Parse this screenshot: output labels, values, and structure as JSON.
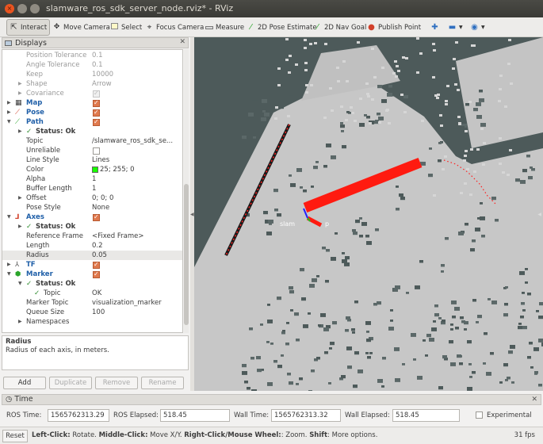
{
  "window": {
    "title": "slamware_ros_sdk_server_node.rviz* - RViz"
  },
  "toolbar": {
    "interact": "Interact",
    "move_camera": "Move Camera",
    "select": "Select",
    "focus_camera": "Focus Camera",
    "measure": "Measure",
    "pose_estimate": "2D Pose Estimate",
    "nav_goal": "2D Nav Goal",
    "publish_point": "Publish Point"
  },
  "displays": {
    "title": "Displays",
    "rows": [
      {
        "key": "Position Tolerance",
        "value": "0.1"
      },
      {
        "key": "Angle Tolerance",
        "value": "0.1"
      },
      {
        "key": "Keep",
        "value": "10000"
      },
      {
        "key": "Shape",
        "value": "Arrow"
      },
      {
        "key": "Covariance",
        "value": ""
      },
      {
        "key": "Map",
        "value": ""
      },
      {
        "key": "Pose",
        "value": ""
      },
      {
        "key": "Path",
        "value": ""
      },
      {
        "key": "Status: Ok",
        "value": ""
      },
      {
        "key": "Topic",
        "value": "/slamware_ros_sdk_se..."
      },
      {
        "key": "Unreliable",
        "value": ""
      },
      {
        "key": "Line Style",
        "value": "Lines"
      },
      {
        "key": "Color",
        "value": "25; 255; 0"
      },
      {
        "key": "Alpha",
        "value": "1"
      },
      {
        "key": "Buffer Length",
        "value": "1"
      },
      {
        "key": "Offset",
        "value": "0; 0; 0"
      },
      {
        "key": "Pose Style",
        "value": "None"
      },
      {
        "key": "Axes",
        "value": ""
      },
      {
        "key": "Status: Ok",
        "value": ""
      },
      {
        "key": "Reference Frame",
        "value": "<Fixed Frame>"
      },
      {
        "key": "Length",
        "value": "0.2"
      },
      {
        "key": "Radius",
        "value": "0.05"
      },
      {
        "key": "TF",
        "value": ""
      },
      {
        "key": "Marker",
        "value": ""
      },
      {
        "key": "Status: Ok",
        "value": ""
      },
      {
        "key": "Topic",
        "value": "OK"
      },
      {
        "key": "Marker Topic",
        "value": "visualization_marker"
      },
      {
        "key": "Queue Size",
        "value": "100"
      },
      {
        "key": "Namespaces",
        "value": ""
      }
    ],
    "description_title": "Radius",
    "description_text": "Radius of each axis, in meters.",
    "buttons": {
      "add": "Add",
      "duplicate": "Duplicate",
      "remove": "Remove",
      "rename": "Rename"
    }
  },
  "viewport": {
    "frame_label_left": "slam",
    "frame_label_right": "p"
  },
  "time": {
    "title": "Time",
    "ros_time_label": "ROS Time:",
    "ros_time": "1565762313.29",
    "ros_elapsed_label": "ROS Elapsed:",
    "ros_elapsed": "518.45",
    "wall_time_label": "Wall Time:",
    "wall_time": "1565762313.32",
    "wall_elapsed_label": "Wall Elapsed:",
    "wall_elapsed": "518.45",
    "experimental": "Experimental"
  },
  "status": {
    "reset": "Reset",
    "left_click": "Left-Click:",
    "left_click_desc": " Rotate. ",
    "middle_click": "Middle-Click:",
    "middle_click_desc": " Move X/Y. ",
    "right_click": "Right-Click/Mouse Wheel:",
    "right_click_desc": ": Zoom. ",
    "shift": "Shift",
    "shift_desc": ": More options.",
    "fps": "31 fps"
  },
  "colors": {
    "path": "#19ff00",
    "marker": "#ff1a10",
    "map_free": "#c8c8c8",
    "map_unknown": "#4d5a5a",
    "map_occupied": "#3a4545"
  }
}
